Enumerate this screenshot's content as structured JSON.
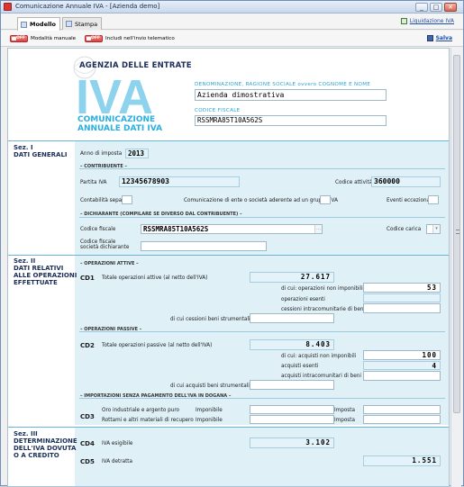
{
  "window": {
    "title": "Comunicazione Annuale IVA - [Azienda demo]",
    "btn_min": "_",
    "btn_max": "□",
    "btn_close": "✕"
  },
  "tabs": [
    {
      "label": "Modello"
    },
    {
      "label": "Stampa"
    }
  ],
  "liquidazione_link": "Liquidazione IVA",
  "toolbar": {
    "toggle1_state": "OFF",
    "toggle1_label": "Modalità manuale",
    "toggle2_state": "OFF",
    "toggle2_label": "Includi nell'invio telematico",
    "save_label": "Salva"
  },
  "header": {
    "agenzia": "AGENZIA DELLE ENTRATE",
    "logo_text": "IVA",
    "comm_line1": "COMUNICAZIONE",
    "comm_line2": "ANNUALE DATI IVA",
    "denominazione_label": "DENOMINAZIONE, RAGIONE SOCIALE ovvero COGNOME E NOME",
    "denominazione_value": "Azienda dimostrativa",
    "cf_label": "CODICE FISCALE",
    "cf_value": "RSSMRA85T10A562S"
  },
  "sez1": {
    "title": "Sez. I",
    "subtitle": "DATI GENERALI",
    "anno_label": "Anno di imposta",
    "anno_value": "2013",
    "contribuente_cap": "– CONTRIBUENTE –",
    "piva_label": "Partita IVA",
    "piva_value": "12345678903",
    "codice_attivita_label": "Codice attività",
    "codice_attivita_value": "360000",
    "contab_label": "Contabilità separata",
    "comunicazione_label": "Comunicazione di ente o società aderente ad un gruppo IVA",
    "eventi_label": "Eventi eccezionali",
    "dichiarante_cap": "– DICHIARANTE (COMPILARE SE DIVERSO DAL CONTRIBUENTE) –",
    "cf_label": "Codice fiscale",
    "cf_value": "RSSMRA85T10A562S",
    "carica_label": "Codice carica",
    "cf_societa_label1": "Codice fiscale",
    "cf_societa_label2": "società dichiarante"
  },
  "sez2": {
    "title": "Sez. II",
    "line2": "DATI RELATIVI",
    "line3": "ALLE OPERAZIONI",
    "line4": "EFFETTUATE",
    "attive_cap": "– OPERAZIONI ATTIVE –",
    "cd1": "CD1",
    "cd1_label": "Totale operazioni attive (al netto dell'IVA)",
    "cd1_value": "27.617",
    "non_imponibili_label": "di cui: operazioni non imponibili",
    "non_imponibili_value": "53",
    "esenti_label": "operazioni esenti",
    "cessioni_label": "cessioni intracomunitarie di beni",
    "beni_strum_label": "di cui cessioni beni strumentali",
    "passive_cap": "– OPERAZIONI PASSIVE –",
    "cd2": "CD2",
    "cd2_label": "Totale operazioni passive (al netto dell'IVA)",
    "cd2_value": "8.403",
    "acq_non_imp_label": "di cui: acquisti non imponibili",
    "acq_non_imp_value": "100",
    "acq_esenti_label": "acquisti esenti",
    "acq_esenti_value": "4",
    "acq_intra_label": "acquisti intracomunitari di beni",
    "acq_strum_label": "di cui acquisti beni strumentali",
    "dogana_cap": "– IMPORTAZIONI SENZA PAGAMENTO DELL'IVA IN DOGANA –",
    "cd3": "CD3",
    "oro_label": "Oro industriale e argento puro",
    "rottami_label": "Rottami e altri materiali di recupero",
    "imponibile_label": "Imponibile",
    "imposta_label": "Imposta"
  },
  "sez3": {
    "title": "Sez. III",
    "line2": "DETERMINAZIONE",
    "line3": "DELL'IVA DOVUTA",
    "line4": "O A CREDITO",
    "cd4": "CD4",
    "cd4_label": "IVA esigibile",
    "cd4_value": "3.102",
    "cd5": "CD5",
    "cd5_label": "IVA detratta",
    "cd5_value": "1.551"
  },
  "colors": {
    "accent": "#29b0e0",
    "band": "#dff0f7",
    "title_navy": "#1b2f5a"
  }
}
